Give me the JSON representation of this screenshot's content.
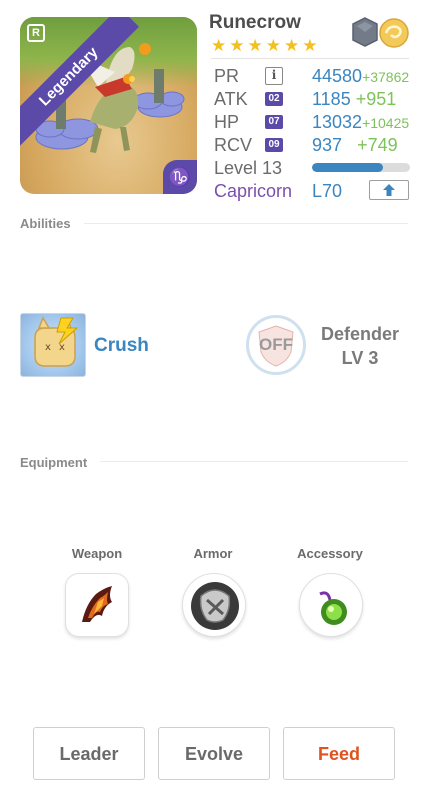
{
  "monster": {
    "name": "Runecrow",
    "rarity": "Legendary",
    "rank_letter": "R",
    "zodiac_symbol": "♑",
    "stars": 6,
    "element_icons": [
      "rock-element-icon",
      "wind-element-icon"
    ]
  },
  "stats": {
    "pr": {
      "label": "PR",
      "badge": "i",
      "value": "44580",
      "bonus": "+37862"
    },
    "atk": {
      "label": "ATK",
      "badge": "02",
      "value": "1185",
      "bonus": "+951"
    },
    "hp": {
      "label": "HP",
      "badge": "07",
      "value": "13032",
      "bonus": "+10425"
    },
    "rcv": {
      "label": "RCV",
      "badge": "09",
      "value": "937",
      "bonus": "+749"
    }
  },
  "level": {
    "text": "Level 13",
    "progress": 0.72
  },
  "sign": {
    "name": "Capricorn",
    "level": "L70",
    "upgrade_icon": "arrow-up-icon"
  },
  "sections": {
    "abilities": "Abilities",
    "equipment": "Equipment"
  },
  "abilities": {
    "ability_name": "Crush",
    "toggle_state": "OFF",
    "passive_name": "Defender",
    "passive_level": "LV 3"
  },
  "equipment": {
    "weapon_label": "Weapon",
    "armor_label": "Armor",
    "accessory_label": "Accessory"
  },
  "buttons": {
    "leader": "Leader",
    "evolve": "Evolve",
    "feed": "Feed"
  },
  "colors": {
    "accent_blue": "#3b86c0",
    "bonus_green": "#7ec25a",
    "rarity_purple": "#5b4aa8",
    "sign_purple": "#7b4fae",
    "feed_orange": "#e0531f",
    "star_gold": "#f4c01e"
  }
}
